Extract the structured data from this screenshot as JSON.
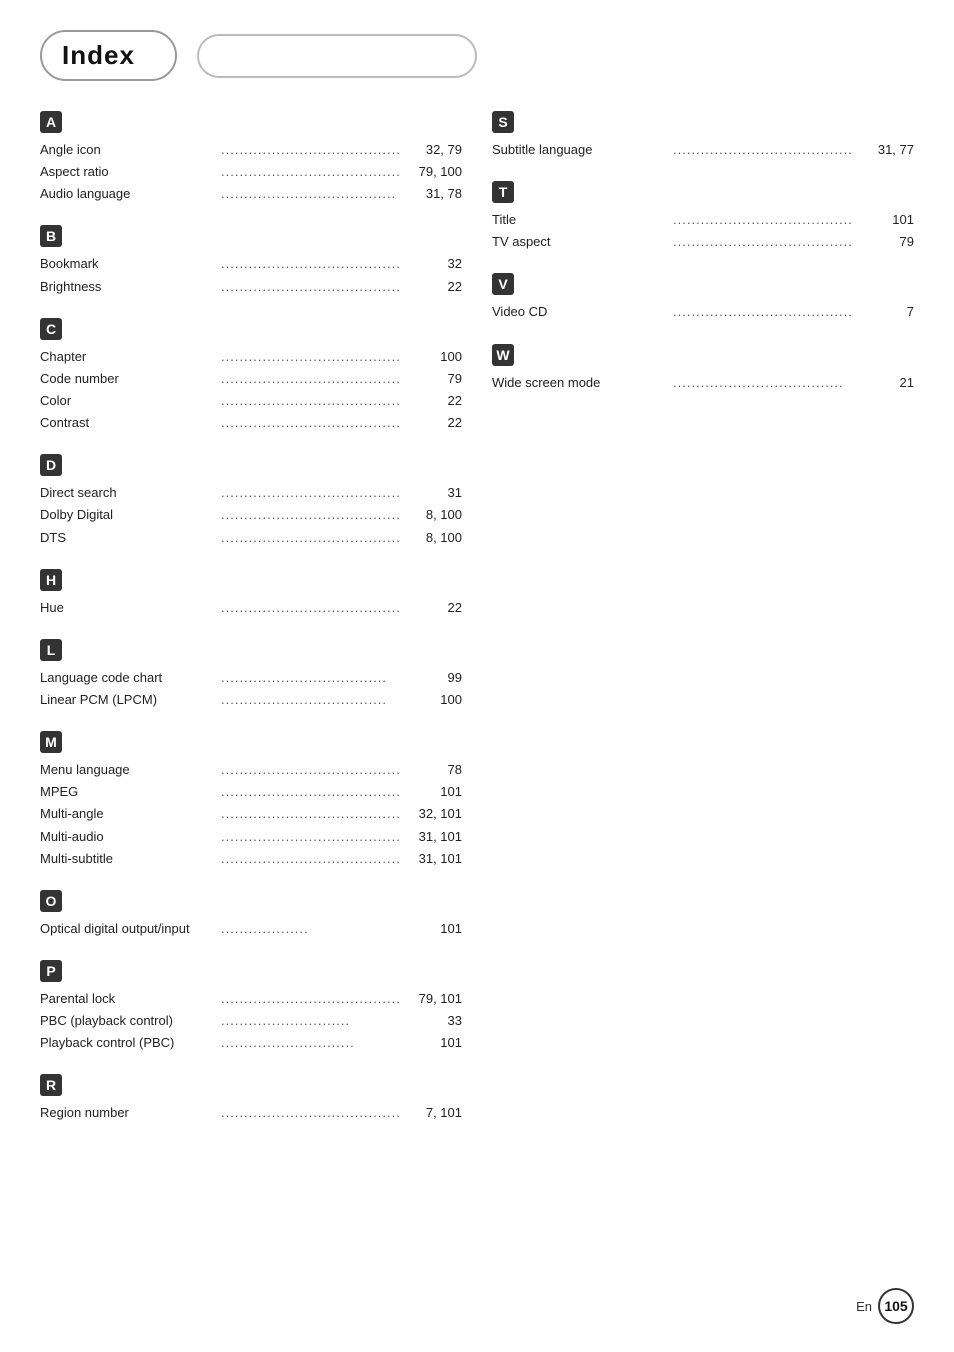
{
  "header": {
    "title": "Index",
    "empty_box_label": ""
  },
  "page_number": "105",
  "page_en": "En",
  "left_sections": [
    {
      "letter": "A",
      "entries": [
        {
          "name": "Angle icon",
          "dots": "................................................",
          "page": "32, 79"
        },
        {
          "name": "Aspect ratio",
          "dots": "..........................................",
          "page": "79, 100"
        },
        {
          "name": "Audio language",
          "dots": "......................................",
          "page": "31, 78"
        }
      ]
    },
    {
      "letter": "B",
      "entries": [
        {
          "name": "Bookmark",
          "dots": ".................................................",
          "page": "32"
        },
        {
          "name": "Brightness",
          "dots": ".................................................",
          "page": "22"
        }
      ]
    },
    {
      "letter": "C",
      "entries": [
        {
          "name": "Chapter",
          "dots": "....................................................",
          "page": "100"
        },
        {
          "name": "Code number",
          "dots": ".............................................",
          "page": "79"
        },
        {
          "name": "Color",
          "dots": "........................................................",
          "page": "22"
        },
        {
          "name": "Contrast",
          "dots": "....................................................",
          "page": "22"
        }
      ]
    },
    {
      "letter": "D",
      "entries": [
        {
          "name": "Direct search",
          "dots": ".............................................",
          "page": "31"
        },
        {
          "name": "Dolby Digital",
          "dots": "...........................................",
          "page": "8, 100"
        },
        {
          "name": "DTS",
          "dots": ".........................................................",
          "page": "8, 100"
        }
      ]
    },
    {
      "letter": "H",
      "entries": [
        {
          "name": "Hue",
          "dots": ".............................................................",
          "page": "22"
        }
      ]
    },
    {
      "letter": "L",
      "entries": [
        {
          "name": "Language code chart",
          "dots": "....................................",
          "page": "99"
        },
        {
          "name": "Linear PCM (LPCM)",
          "dots": "....................................",
          "page": "100"
        }
      ]
    },
    {
      "letter": "M",
      "entries": [
        {
          "name": "Menu language",
          "dots": "...........................................",
          "page": "78"
        },
        {
          "name": "MPEG",
          "dots": "........................................................",
          "page": "101"
        },
        {
          "name": "Multi-angle",
          "dots": ".............................................",
          "page": "32, 101"
        },
        {
          "name": "Multi-audio",
          "dots": "................................................",
          "page": "31, 101"
        },
        {
          "name": "Multi-subtitle",
          "dots": "............................................",
          "page": "31, 101"
        }
      ]
    },
    {
      "letter": "O",
      "entries": [
        {
          "name": "Optical digital output/input",
          "dots": "...................",
          "page": "101"
        }
      ]
    },
    {
      "letter": "P",
      "entries": [
        {
          "name": "Parental lock",
          "dots": "............................................",
          "page": "79, 101"
        },
        {
          "name": "PBC (playback control)",
          "dots": "............................",
          "page": "33"
        },
        {
          "name": "Playback control (PBC)",
          "dots": ".............................",
          "page": "101"
        }
      ]
    },
    {
      "letter": "R",
      "entries": [
        {
          "name": "Region number",
          "dots": "...........................................",
          "page": "7, 101"
        }
      ]
    }
  ],
  "right_sections": [
    {
      "letter": "S",
      "entries": [
        {
          "name": "Subtitle language",
          "dots": ".......................................",
          "page": "31, 77"
        }
      ]
    },
    {
      "letter": "T",
      "entries": [
        {
          "name": "Title",
          "dots": "............................................................",
          "page": "101"
        },
        {
          "name": "TV aspect",
          "dots": "...................................................",
          "page": "79"
        }
      ]
    },
    {
      "letter": "V",
      "entries": [
        {
          "name": "Video CD",
          "dots": "...................................................",
          "page": "7"
        }
      ]
    },
    {
      "letter": "W",
      "entries": [
        {
          "name": "Wide screen mode",
          "dots": ".....................................",
          "page": "21"
        }
      ]
    }
  ]
}
